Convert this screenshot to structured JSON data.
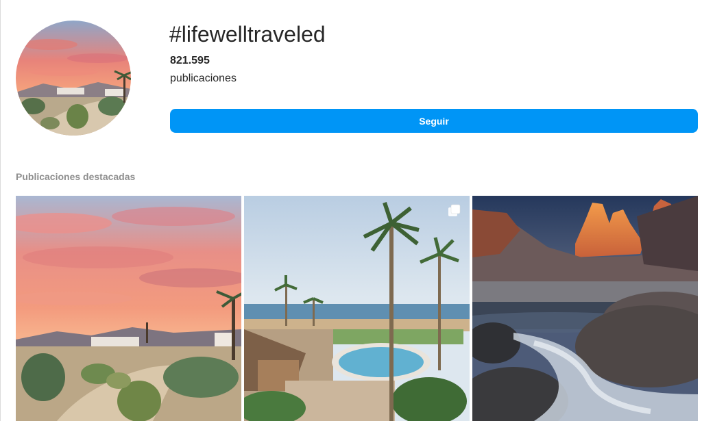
{
  "header": {
    "hashtag": "#lifewelltraveled",
    "post_count": "821.595",
    "post_label": "publicaciones",
    "follow_label": "Seguir"
  },
  "featured": {
    "title": "Publicaciones destacadas",
    "posts": [
      {
        "scene": "desert-sunset-cactus-garden",
        "icon": null
      },
      {
        "scene": "tropical-resort-palm-trees-pool",
        "icon": "multiple-photos-icon"
      },
      {
        "scene": "mountain-peaks-river-long-exposure",
        "icon": null
      }
    ]
  },
  "colors": {
    "accent": "#0095f6",
    "text": "#262626",
    "muted": "#8e8e8e"
  }
}
